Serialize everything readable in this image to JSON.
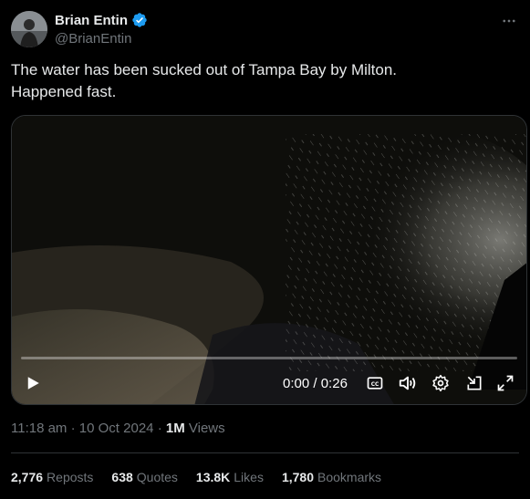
{
  "author": {
    "name": "Brian Entin",
    "handle": "@BrianEntin",
    "verified": true
  },
  "tweet": {
    "text_line1": "The water has been sucked out of Tampa Bay by Milton.",
    "text_line2": "Happened fast."
  },
  "video": {
    "current_time": "0:00",
    "separator": "/",
    "duration": "0:26",
    "progress_fraction": 0,
    "controls": [
      "play-icon",
      "captions-icon",
      "volume-icon",
      "settings-icon",
      "pip-icon",
      "fullscreen-icon"
    ]
  },
  "meta": {
    "time": "11:18 am",
    "date": "10 Oct 2024",
    "views_count": "1M",
    "views_label": "Views"
  },
  "stats": {
    "reposts_count": "2,776",
    "reposts_label": "Reposts",
    "quotes_count": "638",
    "quotes_label": "Quotes",
    "likes_count": "13.8K",
    "likes_label": "Likes",
    "bookmarks_count": "1,780",
    "bookmarks_label": "Bookmarks"
  },
  "colors": {
    "background": "#000000",
    "text_primary": "#e7e9ea",
    "text_secondary": "#71767b",
    "verified_blue": "#1d9bf0",
    "divider": "#2f3336"
  }
}
